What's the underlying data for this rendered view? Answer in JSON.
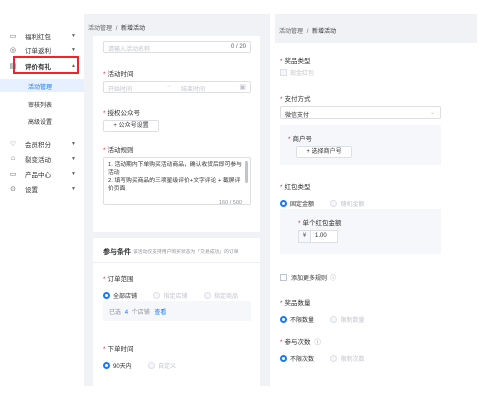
{
  "sidebar": {
    "items": [
      {
        "icon": "gift-icon",
        "glyph": "▭",
        "label": "福利红包"
      },
      {
        "icon": "order-icon",
        "glyph": "◎",
        "label": "订单返利"
      },
      {
        "icon": "review-icon",
        "glyph": "▤",
        "label": "评价有礼",
        "expanded": true
      },
      {
        "icon": "member-icon",
        "glyph": "♡",
        "label": "会员积分"
      },
      {
        "icon": "bargain-icon",
        "glyph": "⌂",
        "label": "裂变活动"
      },
      {
        "icon": "product-icon",
        "glyph": "▭",
        "label": "产品中心"
      },
      {
        "icon": "settings-icon",
        "glyph": "⊙",
        "label": "设置"
      }
    ],
    "sub_items": [
      {
        "label": "活动管理",
        "active": true
      },
      {
        "label": "审核列表",
        "active": false
      },
      {
        "label": "高级设置",
        "active": false
      }
    ],
    "highlight_color": "#f5222d",
    "active_color": "#1677ff"
  },
  "left_panel": {
    "breadcrumb": {
      "parent": "活动管理",
      "sep": "/",
      "current": "新增活动"
    },
    "name_input": {
      "placeholder": "请输入活动名称",
      "count": "0 / 20"
    },
    "time": {
      "label": "活动时间",
      "start_placeholder": "开始时间",
      "arrow": "→",
      "end_placeholder": "结束时间"
    },
    "authorize": {
      "label": "授权公众号",
      "button": "+ 公众号设置"
    },
    "rules": {
      "label": "活动规则",
      "lines": [
        "1. 活动期内下单购买活动商品，确认收货后即可参与活动",
        "2. 填写购买商品的三项星级评价+文字评论 + 截屏评价页面"
      ],
      "count": "160 / 500"
    },
    "conditions": {
      "title": "参与条件",
      "note": "该活动仅支持用户购买状态为「交易成功」的订单",
      "scope_label": "订单范围",
      "scope_options": [
        "全部店铺",
        "指定店铺",
        "指定商品"
      ],
      "selected_prefix": "已选",
      "selected_count": "4",
      "selected_unit": "个店铺",
      "view": "查看",
      "time_label": "下单时间",
      "time_options": [
        "90天内",
        "自定义"
      ]
    }
  },
  "right_panel": {
    "breadcrumb": {
      "parent": "活动管理",
      "sep": "/",
      "current": "新增活动"
    },
    "prize_type": {
      "label": "奖品类型",
      "option": "现金红包"
    },
    "payment": {
      "label": "支付方式",
      "value": "微信支付"
    },
    "merchant": {
      "label": "商户号",
      "button": "+ 选择商户号"
    },
    "red_packet": {
      "label": "红包类型",
      "options": [
        "固定金额",
        "随机金额"
      ]
    },
    "amount": {
      "label": "单个红包金额",
      "prefix": "¥",
      "value": "1.00"
    },
    "more_rules": {
      "label": "添加更多规则",
      "icon": "ⓘ"
    },
    "prize_qty": {
      "label": "奖品数量",
      "options": [
        "不限数量",
        "限制数量"
      ]
    },
    "participate": {
      "label": "参与次数",
      "icon": "ⓘ",
      "options": [
        "不限次数",
        "限制次数"
      ]
    }
  }
}
